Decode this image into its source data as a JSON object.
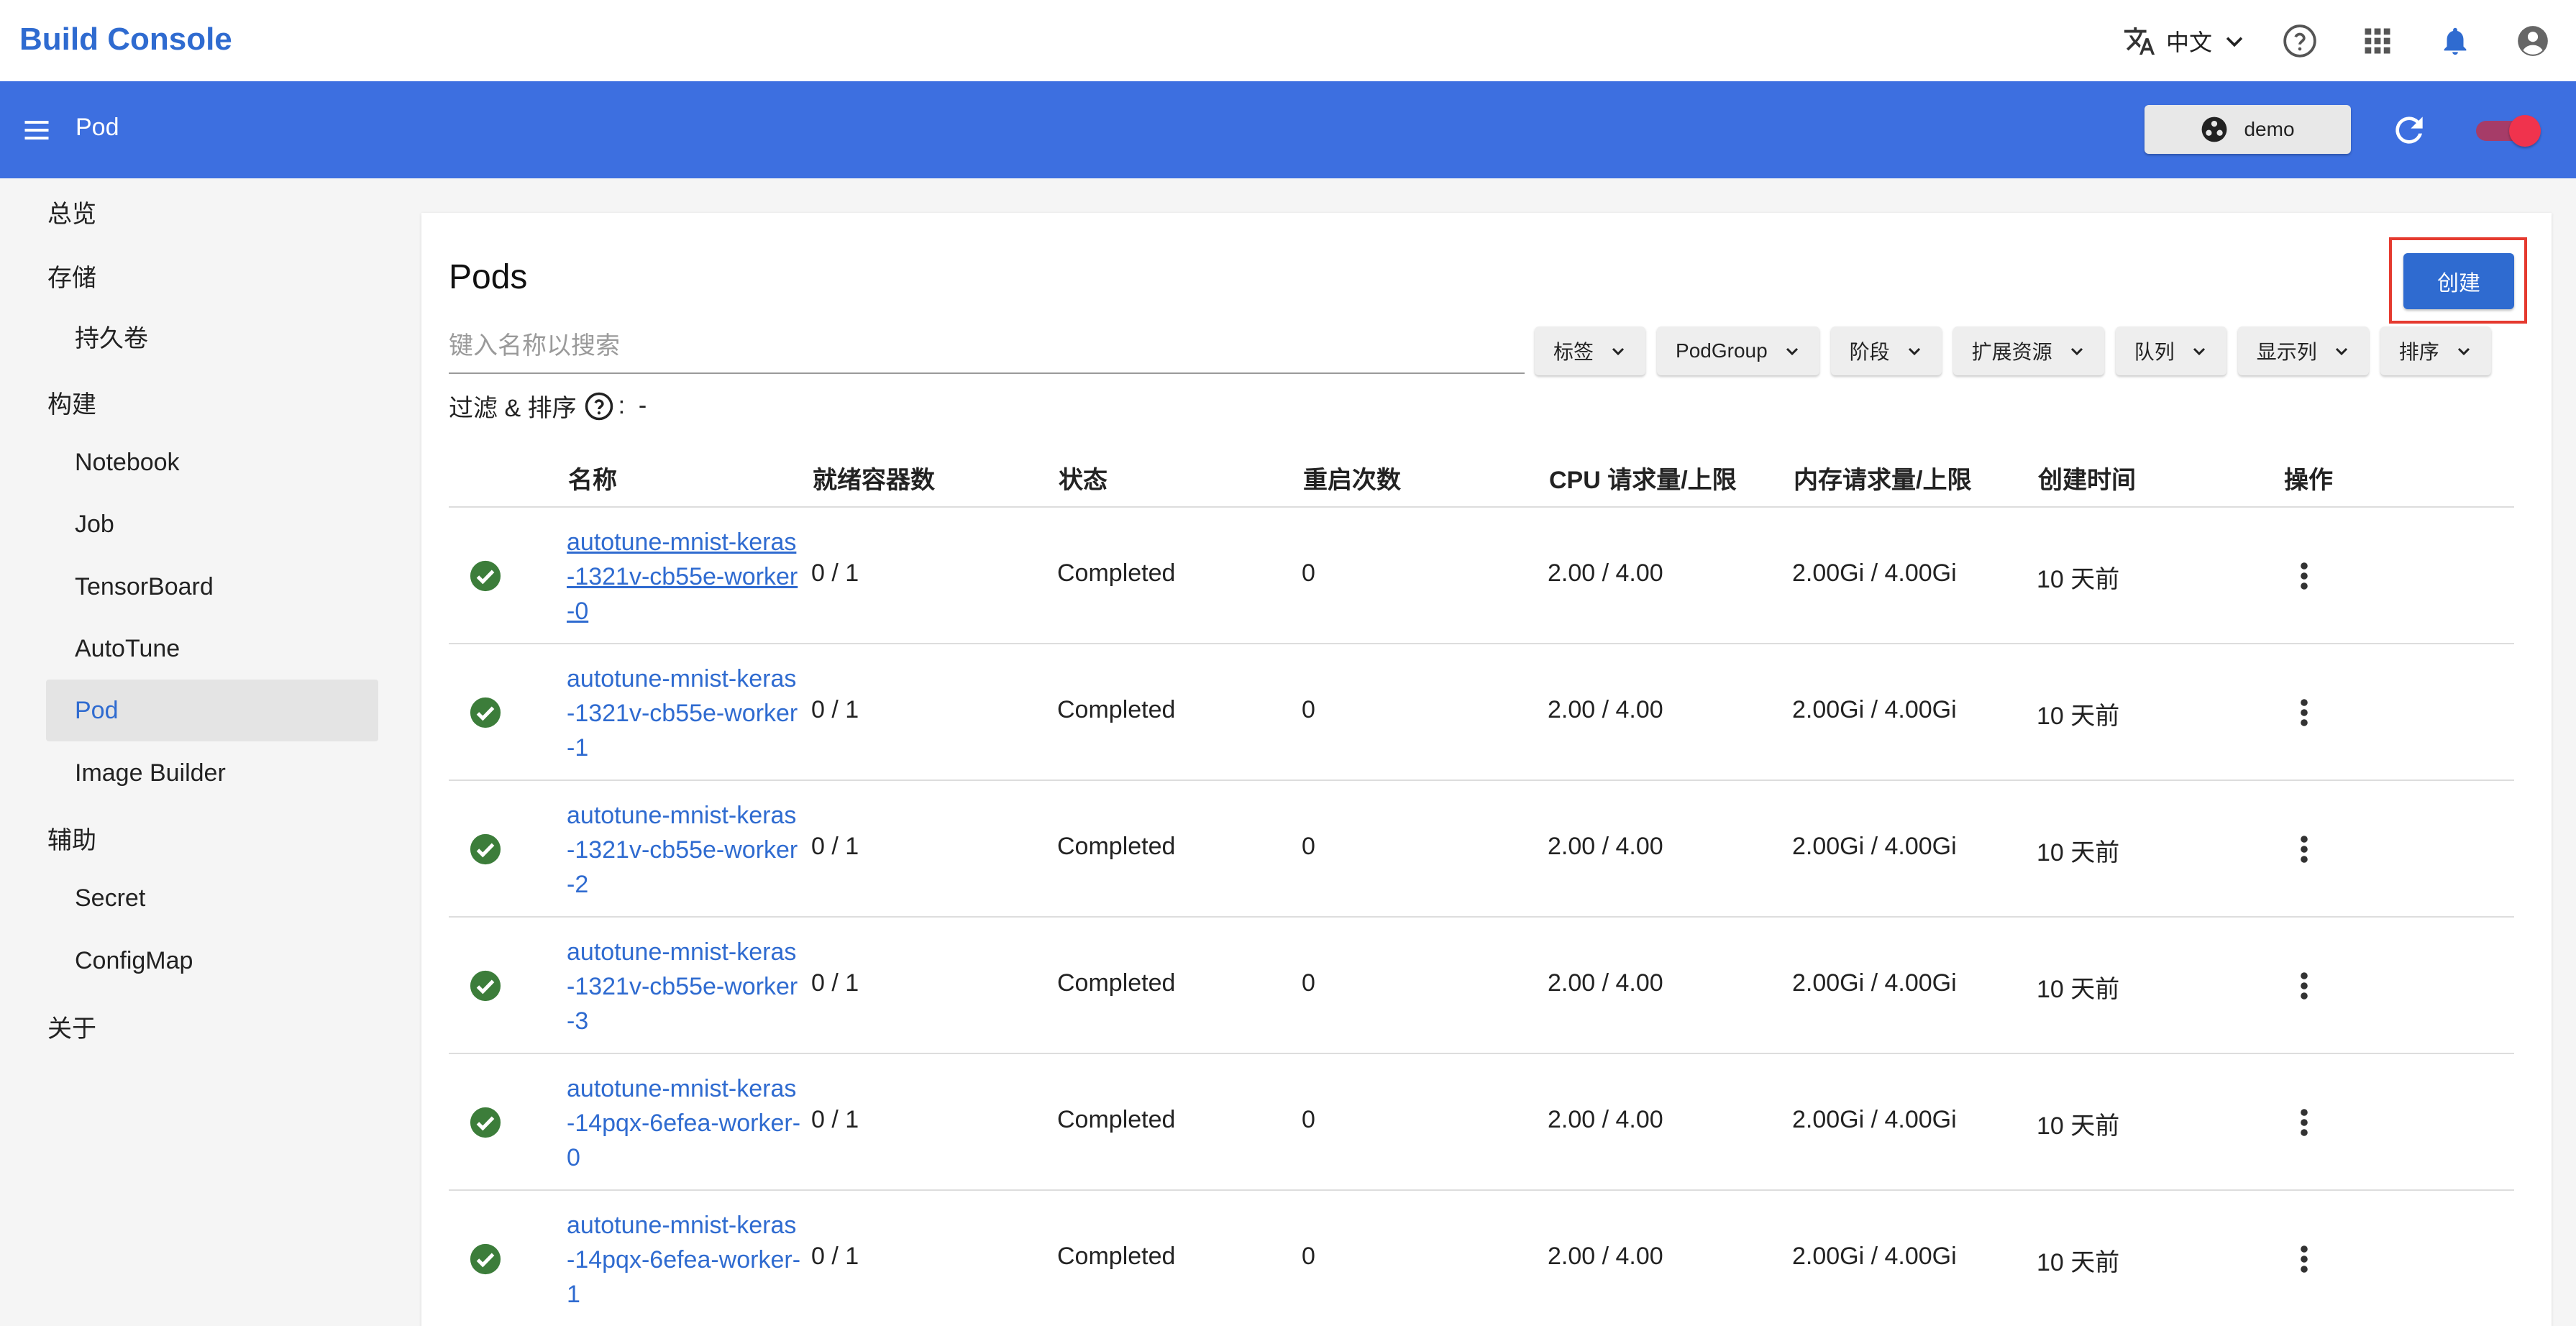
{
  "app": {
    "brand": "Build Console"
  },
  "topbar": {
    "language_label": "中文",
    "icons": [
      "translate-icon",
      "chevron-down-icon",
      "help-icon",
      "apps-icon",
      "bell-icon",
      "account-icon"
    ]
  },
  "appbar": {
    "title": "Pod",
    "namespace_label": "demo"
  },
  "sidebar": {
    "items": [
      {
        "label": "总览",
        "type": "group"
      },
      {
        "label": "存储",
        "type": "group"
      },
      {
        "label": "持久卷",
        "type": "item"
      },
      {
        "label": "构建",
        "type": "group"
      },
      {
        "label": "Notebook",
        "type": "item"
      },
      {
        "label": "Job",
        "type": "item"
      },
      {
        "label": "TensorBoard",
        "type": "item"
      },
      {
        "label": "AutoTune",
        "type": "item"
      },
      {
        "label": "Pod",
        "type": "item",
        "active": true
      },
      {
        "label": "Image Builder",
        "type": "item"
      },
      {
        "label": "辅助",
        "type": "group"
      },
      {
        "label": "Secret",
        "type": "item"
      },
      {
        "label": "ConfigMap",
        "type": "item"
      },
      {
        "label": "关于",
        "type": "group"
      }
    ]
  },
  "main": {
    "title": "Pods",
    "create_label": "创建",
    "search_placeholder": "键入名称以搜索",
    "filters": [
      "标签",
      "PodGroup",
      "阶段",
      "扩展资源",
      "队列",
      "显示列",
      "排序"
    ],
    "filter_info_label": "过滤 & 排序",
    "filter_info_value": "-",
    "columns": [
      "名称",
      "就绪容器数",
      "状态",
      "重启次数",
      "CPU 请求量/上限",
      "内存请求量/上限",
      "创建时间",
      "操作"
    ],
    "rows": [
      {
        "name": "autotune-mnist-keras-1321v-cb55e-worker-0",
        "ready": "0 / 1",
        "status": "Completed",
        "restarts": "0",
        "cpu": "2.00 / 4.00",
        "memory": "2.00Gi / 4.00Gi",
        "created": "10 天前"
      },
      {
        "name": "autotune-mnist-keras-1321v-cb55e-worker-1",
        "ready": "0 / 1",
        "status": "Completed",
        "restarts": "0",
        "cpu": "2.00 / 4.00",
        "memory": "2.00Gi / 4.00Gi",
        "created": "10 天前"
      },
      {
        "name": "autotune-mnist-keras-1321v-cb55e-worker-2",
        "ready": "0 / 1",
        "status": "Completed",
        "restarts": "0",
        "cpu": "2.00 / 4.00",
        "memory": "2.00Gi / 4.00Gi",
        "created": "10 天前"
      },
      {
        "name": "autotune-mnist-keras-1321v-cb55e-worker-3",
        "ready": "0 / 1",
        "status": "Completed",
        "restarts": "0",
        "cpu": "2.00 / 4.00",
        "memory": "2.00Gi / 4.00Gi",
        "created": "10 天前"
      },
      {
        "name": "autotune-mnist-keras-14pqx-6efea-worker-0",
        "ready": "0 / 1",
        "status": "Completed",
        "restarts": "0",
        "cpu": "2.00 / 4.00",
        "memory": "2.00Gi / 4.00Gi",
        "created": "10 天前"
      },
      {
        "name": "autotune-mnist-keras-14pqx-6efea-worker-1",
        "ready": "0 / 1",
        "status": "Completed",
        "restarts": "0",
        "cpu": "2.00 / 4.00",
        "memory": "2.00Gi / 4.00Gi",
        "created": "10 天前"
      }
    ]
  },
  "colors": {
    "brand": "#2f6bd0",
    "appbar": "#3d6fe0",
    "success": "#3c7d3a",
    "highlight": "#e53a2f",
    "toggle": "#f0334d"
  }
}
